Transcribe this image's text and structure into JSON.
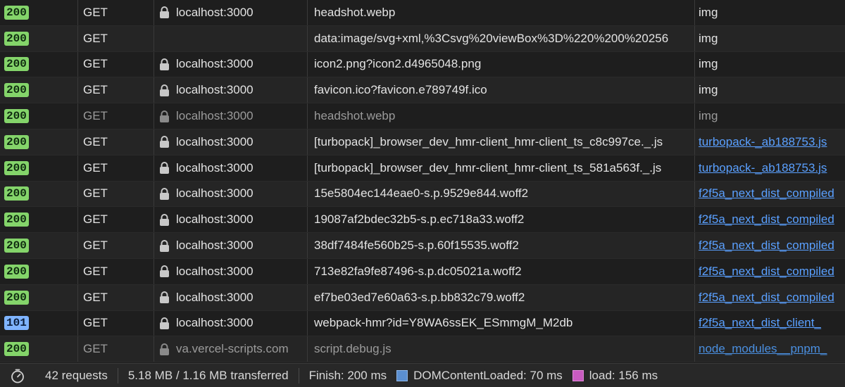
{
  "rows": [
    {
      "status": "200",
      "method": "GET",
      "domain": "localhost:3000",
      "secure": true,
      "name": "headshot.webp",
      "initiator": "img",
      "initiator_link": false,
      "dim": false
    },
    {
      "status": "200",
      "method": "GET",
      "domain": "",
      "secure": false,
      "name": "data:image/svg+xml,%3Csvg%20viewBox%3D%220%200%20256",
      "initiator": "img",
      "initiator_link": false,
      "dim": false
    },
    {
      "status": "200",
      "method": "GET",
      "domain": "localhost:3000",
      "secure": true,
      "name": "icon2.png?icon2.d4965048.png",
      "initiator": "img",
      "initiator_link": false,
      "dim": false
    },
    {
      "status": "200",
      "method": "GET",
      "domain": "localhost:3000",
      "secure": true,
      "name": "favicon.ico?favicon.e789749f.ico",
      "initiator": "img",
      "initiator_link": false,
      "dim": false
    },
    {
      "status": "200",
      "method": "GET",
      "domain": "localhost:3000",
      "secure": true,
      "name": "headshot.webp",
      "initiator": "img",
      "initiator_link": false,
      "dim": true
    },
    {
      "status": "200",
      "method": "GET",
      "domain": "localhost:3000",
      "secure": true,
      "name": "[turbopack]_browser_dev_hmr-client_hmr-client_ts_c8c997ce._.js",
      "initiator": "turbopack-_ab188753.js",
      "initiator_link": true,
      "dim": false
    },
    {
      "status": "200",
      "method": "GET",
      "domain": "localhost:3000",
      "secure": true,
      "name": "[turbopack]_browser_dev_hmr-client_hmr-client_ts_581a563f._.js",
      "initiator": "turbopack-_ab188753.js",
      "initiator_link": true,
      "dim": false
    },
    {
      "status": "200",
      "method": "GET",
      "domain": "localhost:3000",
      "secure": true,
      "name": "15e5804ec144eae0-s.p.9529e844.woff2",
      "initiator": "f2f5a_next_dist_compiled",
      "initiator_link": true,
      "dim": false
    },
    {
      "status": "200",
      "method": "GET",
      "domain": "localhost:3000",
      "secure": true,
      "name": "19087af2bdec32b5-s.p.ec718a33.woff2",
      "initiator": "f2f5a_next_dist_compiled",
      "initiator_link": true,
      "dim": false
    },
    {
      "status": "200",
      "method": "GET",
      "domain": "localhost:3000",
      "secure": true,
      "name": "38df7484fe560b25-s.p.60f15535.woff2",
      "initiator": "f2f5a_next_dist_compiled",
      "initiator_link": true,
      "dim": false
    },
    {
      "status": "200",
      "method": "GET",
      "domain": "localhost:3000",
      "secure": true,
      "name": "713e82fa9fe87496-s.p.dc05021a.woff2",
      "initiator": "f2f5a_next_dist_compiled",
      "initiator_link": true,
      "dim": false
    },
    {
      "status": "200",
      "method": "GET",
      "domain": "localhost:3000",
      "secure": true,
      "name": "ef7be03ed7e60a63-s.p.bb832c79.woff2",
      "initiator": "f2f5a_next_dist_compiled",
      "initiator_link": true,
      "dim": false
    },
    {
      "status": "101",
      "method": "GET",
      "domain": "localhost:3000",
      "secure": true,
      "name": "webpack-hmr?id=Y8WA6ssEK_ESmmgM_M2db",
      "initiator": "f2f5a_next_dist_client_",
      "initiator_link": true,
      "dim": false
    },
    {
      "status": "200",
      "method": "GET",
      "domain": "va.vercel-scripts.com",
      "secure": true,
      "name": "script.debug.js",
      "initiator": "node_modules__pnpm_",
      "initiator_link": true,
      "dim": true
    }
  ],
  "footer": {
    "requests": "42 requests",
    "transferred": "5.18 MB / 1.16 MB transferred",
    "finish": "Finish: 200 ms",
    "dom_content_loaded": "DOMContentLoaded: 70 ms",
    "load": "load: 156 ms"
  },
  "colors": {
    "status_ok": "#84d46a",
    "status_info": "#7fb4ff",
    "dcl_marker": "#5b8fd0",
    "load_marker": "#c85bc0",
    "link": "#5aa0ff"
  },
  "icons": {
    "lock": "lock-icon",
    "timer": "stopwatch-icon"
  }
}
